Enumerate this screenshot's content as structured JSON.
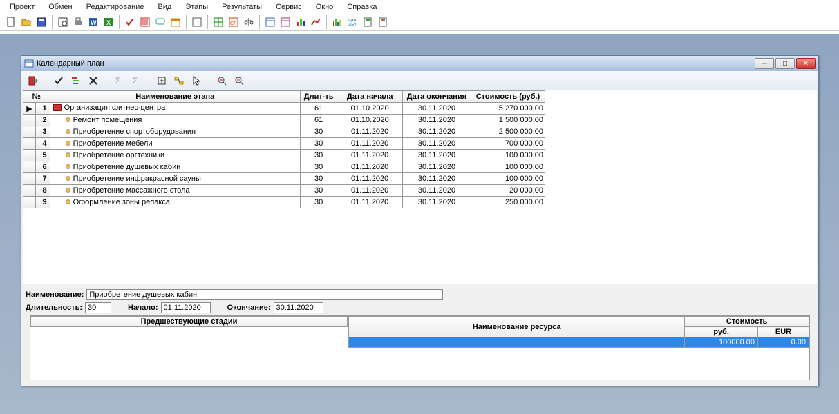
{
  "menu": [
    "Проект",
    "Обмен",
    "Редактирование",
    "Вид",
    "Этапы",
    "Результаты",
    "Сервис",
    "Окно",
    "Справка"
  ],
  "window_title": "Календарный план",
  "columns": {
    "num": "№",
    "name": "Наименование этапа",
    "dur": "Длит-ть",
    "ds": "Дата начала",
    "de": "Дата окончания",
    "cost": "Стоимость (руб.)"
  },
  "rows": [
    {
      "n": "1",
      "name": "Организация фитнес-центра",
      "dur": "61",
      "ds": "01.10.2020",
      "de": "30.11.2020",
      "cost": "5 270 000,00",
      "root": true,
      "ptr": true
    },
    {
      "n": "2",
      "name": "Ремонт помещения",
      "dur": "61",
      "ds": "01.10.2020",
      "de": "30.11.2020",
      "cost": "1 500 000,00"
    },
    {
      "n": "3",
      "name": "Приобретение спортоборудования",
      "dur": "30",
      "ds": "01.11.2020",
      "de": "30.11.2020",
      "cost": "2 500 000,00"
    },
    {
      "n": "4",
      "name": "Приобретение мебели",
      "dur": "30",
      "ds": "01.11.2020",
      "de": "30.11.2020",
      "cost": "700 000,00"
    },
    {
      "n": "5",
      "name": "Приобретение оргтехники",
      "dur": "30",
      "ds": "01.11.2020",
      "de": "30.11.2020",
      "cost": "100 000,00"
    },
    {
      "n": "6",
      "name": "Приобретение душевых кабин",
      "dur": "30",
      "ds": "01.11.2020",
      "de": "30.11.2020",
      "cost": "100 000,00"
    },
    {
      "n": "7",
      "name": "Приобретение инфракрасной сауны",
      "dur": "30",
      "ds": "01.11.2020",
      "de": "30.11.2020",
      "cost": "100 000,00"
    },
    {
      "n": "8",
      "name": "Приобретение массажного стола",
      "dur": "30",
      "ds": "01.11.2020",
      "de": "30.11.2020",
      "cost": "20 000,00"
    },
    {
      "n": "9",
      "name": "Оформление зоны релакса",
      "dur": "30",
      "ds": "01.11.2020",
      "de": "30.11.2020",
      "cost": "250 000,00"
    }
  ],
  "detail": {
    "labels": {
      "name": "Наименование:",
      "dur": "Длительность:",
      "start": "Начало:",
      "end": "Окончание:"
    },
    "name": "Приобретение душевых кабин",
    "dur": "30",
    "start": "01.11.2020",
    "end": "30.11.2020"
  },
  "split": {
    "left_header": "Предшествующие стадии",
    "right_header": "Наименование ресурса",
    "cost_header": "Стоимость",
    "rub": "руб.",
    "eur": "EUR",
    "row_rub": "100000.00",
    "row_eur": "0.00"
  }
}
